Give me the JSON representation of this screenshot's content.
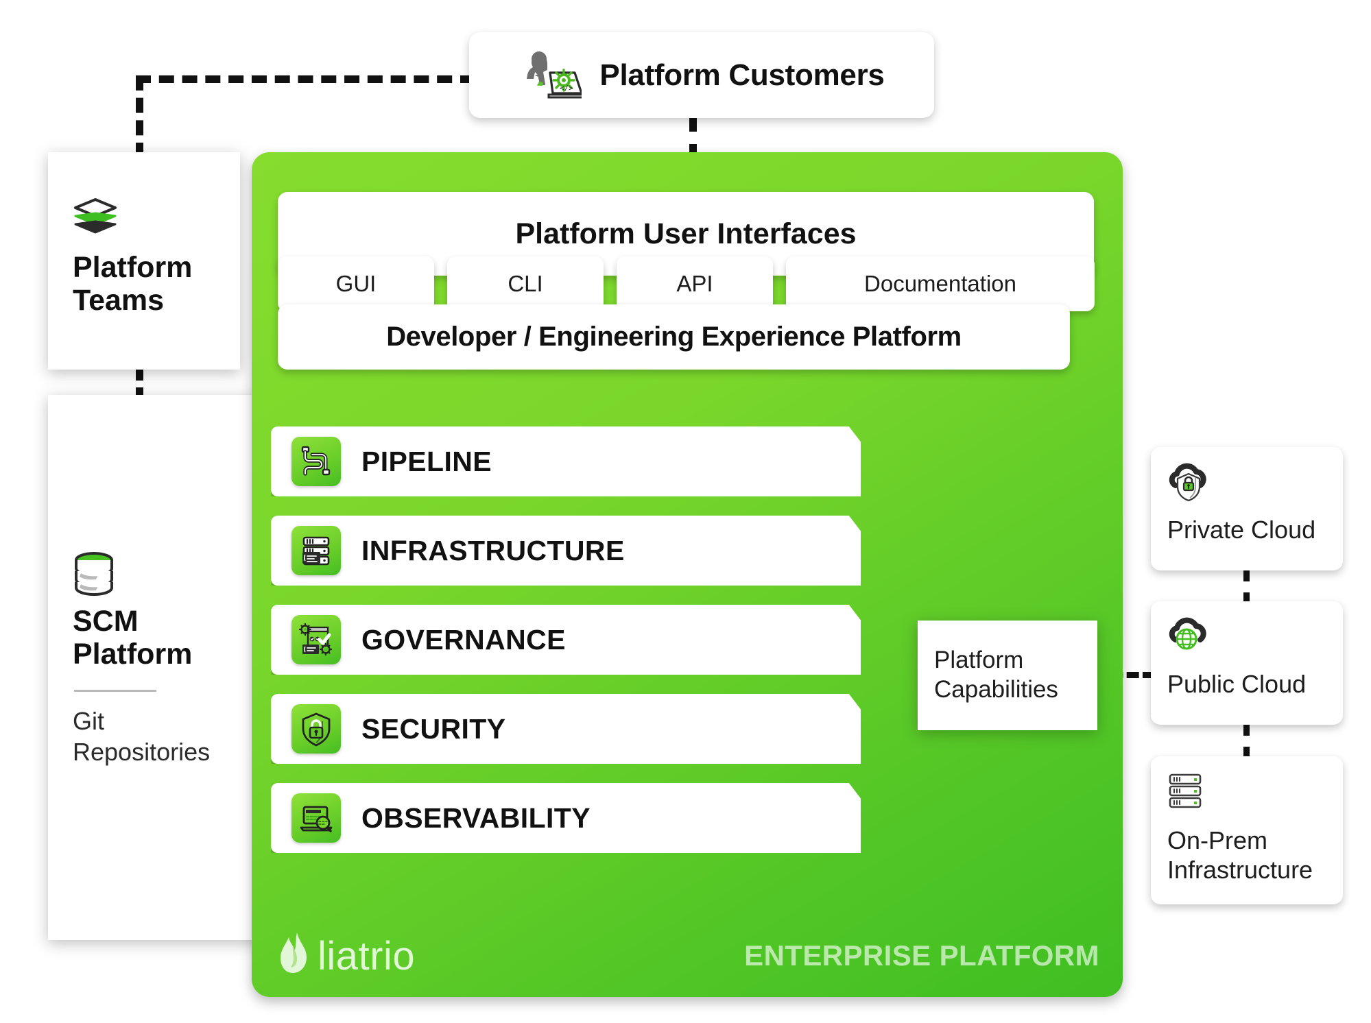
{
  "diagram": {
    "title": "Enterprise Platform",
    "brand": "liatrio",
    "footer_label": "ENTERPRISE PLATFORM",
    "colors": {
      "brand_green": "#7ED321",
      "panel_gradient_start": "#86dd2e",
      "panel_gradient_end": "#3fbe22",
      "icon_green": "#6ccf2a",
      "accent_dark": "#111111"
    }
  },
  "customers": {
    "label": "Platform Customers",
    "icon": "developer-at-laptop-icon"
  },
  "platform": {
    "user_interfaces": {
      "title": "Platform User Interfaces",
      "channels": [
        {
          "label": "GUI"
        },
        {
          "label": "CLI"
        },
        {
          "label": "API"
        },
        {
          "label": "Documentation"
        }
      ]
    },
    "experience_platform": {
      "title": "Developer / Engineering Experience Platform"
    },
    "capabilities": [
      {
        "label": "PIPELINE",
        "icon": "pipeline-icon"
      },
      {
        "label": "INFRASTRUCTURE",
        "icon": "server-rack-icon"
      },
      {
        "label": "GOVERNANCE",
        "icon": "gears-checklist-icon"
      },
      {
        "label": "SECURITY",
        "icon": "shield-lock-icon"
      },
      {
        "label": "OBSERVABILITY",
        "icon": "laptop-magnifier-icon"
      }
    ],
    "capabilities_callout": {
      "line1": "Platform",
      "line2": "Capabilities"
    }
  },
  "left_cards": {
    "platform_teams": {
      "title_line1": "Platform",
      "title_line2": "Teams",
      "icon": "layers-icon"
    },
    "scm_platform": {
      "title_line1": "SCM",
      "title_line2": "Platform",
      "subtitle_line1": "Git",
      "subtitle_line2": "Repositories",
      "icon": "database-icon"
    }
  },
  "right_cards": [
    {
      "label": "Private Cloud",
      "icon": "cloud-shield-lock-icon"
    },
    {
      "label": "Public Cloud",
      "icon": "cloud-globe-icon"
    },
    {
      "label_line1": "On-Prem",
      "label_line2": "Infrastructure",
      "icon": "server-stack-icon"
    }
  ]
}
